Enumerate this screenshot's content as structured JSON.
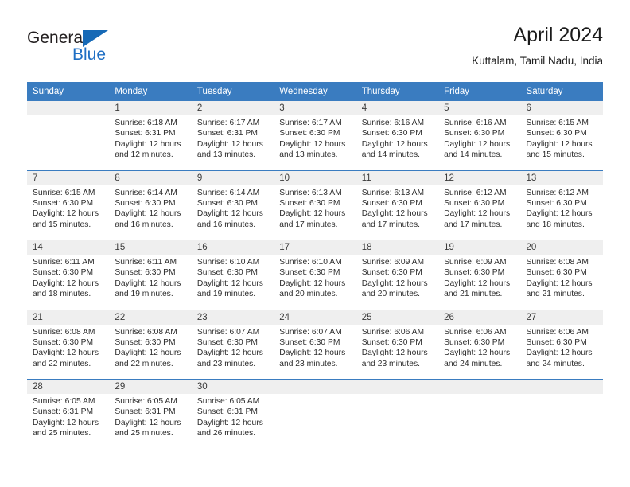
{
  "logo": {
    "word1": "General",
    "word2": "Blue",
    "triangle_color": "#1669b6",
    "blue_text_color": "#1f6fc4"
  },
  "header": {
    "title": "April 2024",
    "subtitle": "Kuttalam, Tamil Nadu, India"
  },
  "theme": {
    "header_bg": "#3a7cc0",
    "daynum_bg": "#efefef",
    "separator": "#3a7cc0"
  },
  "columns": [
    "Sunday",
    "Monday",
    "Tuesday",
    "Wednesday",
    "Thursday",
    "Friday",
    "Saturday"
  ],
  "weeks": [
    {
      "days": [
        {
          "num": "",
          "lines": []
        },
        {
          "num": "1",
          "lines": [
            "Sunrise: 6:18 AM",
            "Sunset: 6:31 PM",
            "Daylight: 12 hours",
            "and 12 minutes."
          ]
        },
        {
          "num": "2",
          "lines": [
            "Sunrise: 6:17 AM",
            "Sunset: 6:31 PM",
            "Daylight: 12 hours",
            "and 13 minutes."
          ]
        },
        {
          "num": "3",
          "lines": [
            "Sunrise: 6:17 AM",
            "Sunset: 6:30 PM",
            "Daylight: 12 hours",
            "and 13 minutes."
          ]
        },
        {
          "num": "4",
          "lines": [
            "Sunrise: 6:16 AM",
            "Sunset: 6:30 PM",
            "Daylight: 12 hours",
            "and 14 minutes."
          ]
        },
        {
          "num": "5",
          "lines": [
            "Sunrise: 6:16 AM",
            "Sunset: 6:30 PM",
            "Daylight: 12 hours",
            "and 14 minutes."
          ]
        },
        {
          "num": "6",
          "lines": [
            "Sunrise: 6:15 AM",
            "Sunset: 6:30 PM",
            "Daylight: 12 hours",
            "and 15 minutes."
          ]
        }
      ]
    },
    {
      "days": [
        {
          "num": "7",
          "lines": [
            "Sunrise: 6:15 AM",
            "Sunset: 6:30 PM",
            "Daylight: 12 hours",
            "and 15 minutes."
          ]
        },
        {
          "num": "8",
          "lines": [
            "Sunrise: 6:14 AM",
            "Sunset: 6:30 PM",
            "Daylight: 12 hours",
            "and 16 minutes."
          ]
        },
        {
          "num": "9",
          "lines": [
            "Sunrise: 6:14 AM",
            "Sunset: 6:30 PM",
            "Daylight: 12 hours",
            "and 16 minutes."
          ]
        },
        {
          "num": "10",
          "lines": [
            "Sunrise: 6:13 AM",
            "Sunset: 6:30 PM",
            "Daylight: 12 hours",
            "and 17 minutes."
          ]
        },
        {
          "num": "11",
          "lines": [
            "Sunrise: 6:13 AM",
            "Sunset: 6:30 PM",
            "Daylight: 12 hours",
            "and 17 minutes."
          ]
        },
        {
          "num": "12",
          "lines": [
            "Sunrise: 6:12 AM",
            "Sunset: 6:30 PM",
            "Daylight: 12 hours",
            "and 17 minutes."
          ]
        },
        {
          "num": "13",
          "lines": [
            "Sunrise: 6:12 AM",
            "Sunset: 6:30 PM",
            "Daylight: 12 hours",
            "and 18 minutes."
          ]
        }
      ]
    },
    {
      "days": [
        {
          "num": "14",
          "lines": [
            "Sunrise: 6:11 AM",
            "Sunset: 6:30 PM",
            "Daylight: 12 hours",
            "and 18 minutes."
          ]
        },
        {
          "num": "15",
          "lines": [
            "Sunrise: 6:11 AM",
            "Sunset: 6:30 PM",
            "Daylight: 12 hours",
            "and 19 minutes."
          ]
        },
        {
          "num": "16",
          "lines": [
            "Sunrise: 6:10 AM",
            "Sunset: 6:30 PM",
            "Daylight: 12 hours",
            "and 19 minutes."
          ]
        },
        {
          "num": "17",
          "lines": [
            "Sunrise: 6:10 AM",
            "Sunset: 6:30 PM",
            "Daylight: 12 hours",
            "and 20 minutes."
          ]
        },
        {
          "num": "18",
          "lines": [
            "Sunrise: 6:09 AM",
            "Sunset: 6:30 PM",
            "Daylight: 12 hours",
            "and 20 minutes."
          ]
        },
        {
          "num": "19",
          "lines": [
            "Sunrise: 6:09 AM",
            "Sunset: 6:30 PM",
            "Daylight: 12 hours",
            "and 21 minutes."
          ]
        },
        {
          "num": "20",
          "lines": [
            "Sunrise: 6:08 AM",
            "Sunset: 6:30 PM",
            "Daylight: 12 hours",
            "and 21 minutes."
          ]
        }
      ]
    },
    {
      "days": [
        {
          "num": "21",
          "lines": [
            "Sunrise: 6:08 AM",
            "Sunset: 6:30 PM",
            "Daylight: 12 hours",
            "and 22 minutes."
          ]
        },
        {
          "num": "22",
          "lines": [
            "Sunrise: 6:08 AM",
            "Sunset: 6:30 PM",
            "Daylight: 12 hours",
            "and 22 minutes."
          ]
        },
        {
          "num": "23",
          "lines": [
            "Sunrise: 6:07 AM",
            "Sunset: 6:30 PM",
            "Daylight: 12 hours",
            "and 23 minutes."
          ]
        },
        {
          "num": "24",
          "lines": [
            "Sunrise: 6:07 AM",
            "Sunset: 6:30 PM",
            "Daylight: 12 hours",
            "and 23 minutes."
          ]
        },
        {
          "num": "25",
          "lines": [
            "Sunrise: 6:06 AM",
            "Sunset: 6:30 PM",
            "Daylight: 12 hours",
            "and 23 minutes."
          ]
        },
        {
          "num": "26",
          "lines": [
            "Sunrise: 6:06 AM",
            "Sunset: 6:30 PM",
            "Daylight: 12 hours",
            "and 24 minutes."
          ]
        },
        {
          "num": "27",
          "lines": [
            "Sunrise: 6:06 AM",
            "Sunset: 6:30 PM",
            "Daylight: 12 hours",
            "and 24 minutes."
          ]
        }
      ]
    },
    {
      "days": [
        {
          "num": "28",
          "lines": [
            "Sunrise: 6:05 AM",
            "Sunset: 6:31 PM",
            "Daylight: 12 hours",
            "and 25 minutes."
          ]
        },
        {
          "num": "29",
          "lines": [
            "Sunrise: 6:05 AM",
            "Sunset: 6:31 PM",
            "Daylight: 12 hours",
            "and 25 minutes."
          ]
        },
        {
          "num": "30",
          "lines": [
            "Sunrise: 6:05 AM",
            "Sunset: 6:31 PM",
            "Daylight: 12 hours",
            "and 26 minutes."
          ]
        },
        {
          "num": "",
          "lines": []
        },
        {
          "num": "",
          "lines": []
        },
        {
          "num": "",
          "lines": []
        },
        {
          "num": "",
          "lines": []
        }
      ]
    }
  ]
}
